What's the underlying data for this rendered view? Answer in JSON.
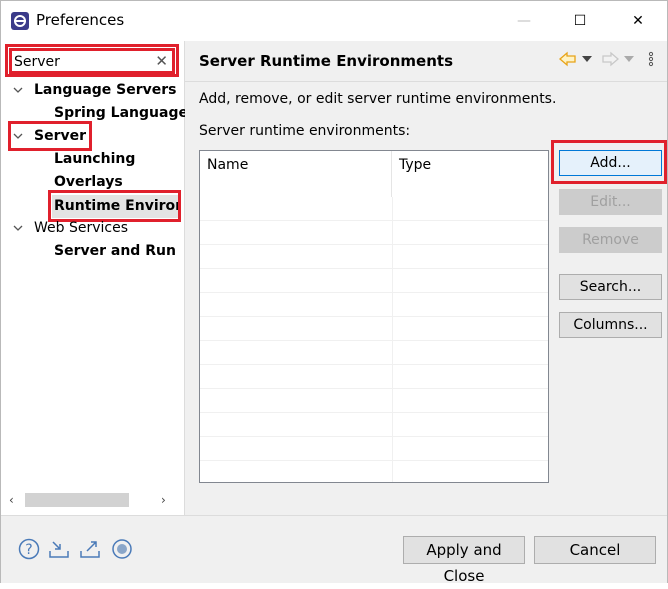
{
  "window": {
    "title": "Preferences",
    "minimize_glyph": "—",
    "maximize_glyph": "☐",
    "close_glyph": "✕"
  },
  "filter": {
    "value": "Server",
    "clear_glyph": "✕"
  },
  "tree": {
    "items": [
      {
        "label": "Language Servers",
        "bold": true,
        "expanded": true
      },
      {
        "label": "Spring Language",
        "bold": true
      },
      {
        "label": "Server",
        "bold": true,
        "expanded": true
      },
      {
        "label": "Launching",
        "bold": true
      },
      {
        "label": "Overlays",
        "bold": true
      },
      {
        "label": "Runtime Environments",
        "bold": true,
        "selected": true
      },
      {
        "label": "Web Services",
        "bold": false,
        "expanded": true
      },
      {
        "label": "Server and Runtime",
        "bold": true
      }
    ],
    "scroll_left": "‹",
    "scroll_right": "›"
  },
  "page": {
    "title": "Server Runtime Environments",
    "description": "Add, remove, or edit server runtime environments.",
    "table_label": "Server runtime environments:",
    "columns": [
      "Name",
      "Type"
    ],
    "rows": []
  },
  "buttons": {
    "add": "Add...",
    "edit": "Edit...",
    "remove": "Remove",
    "search": "Search...",
    "columns": "Columns..."
  },
  "footer": {
    "apply_close": "Apply and Close",
    "cancel": "Cancel"
  },
  "colors": {
    "highlight": "#e0202c",
    "accent": "#0078d7",
    "nav_arrow": "#e8a317"
  },
  "icons": {
    "app": "eclipse-icon",
    "back": "back-arrow-icon",
    "forward": "forward-arrow-icon",
    "menu": "view-menu-icon",
    "help": "help-icon",
    "import": "import-icon",
    "export": "export-icon",
    "record": "record-icon"
  }
}
